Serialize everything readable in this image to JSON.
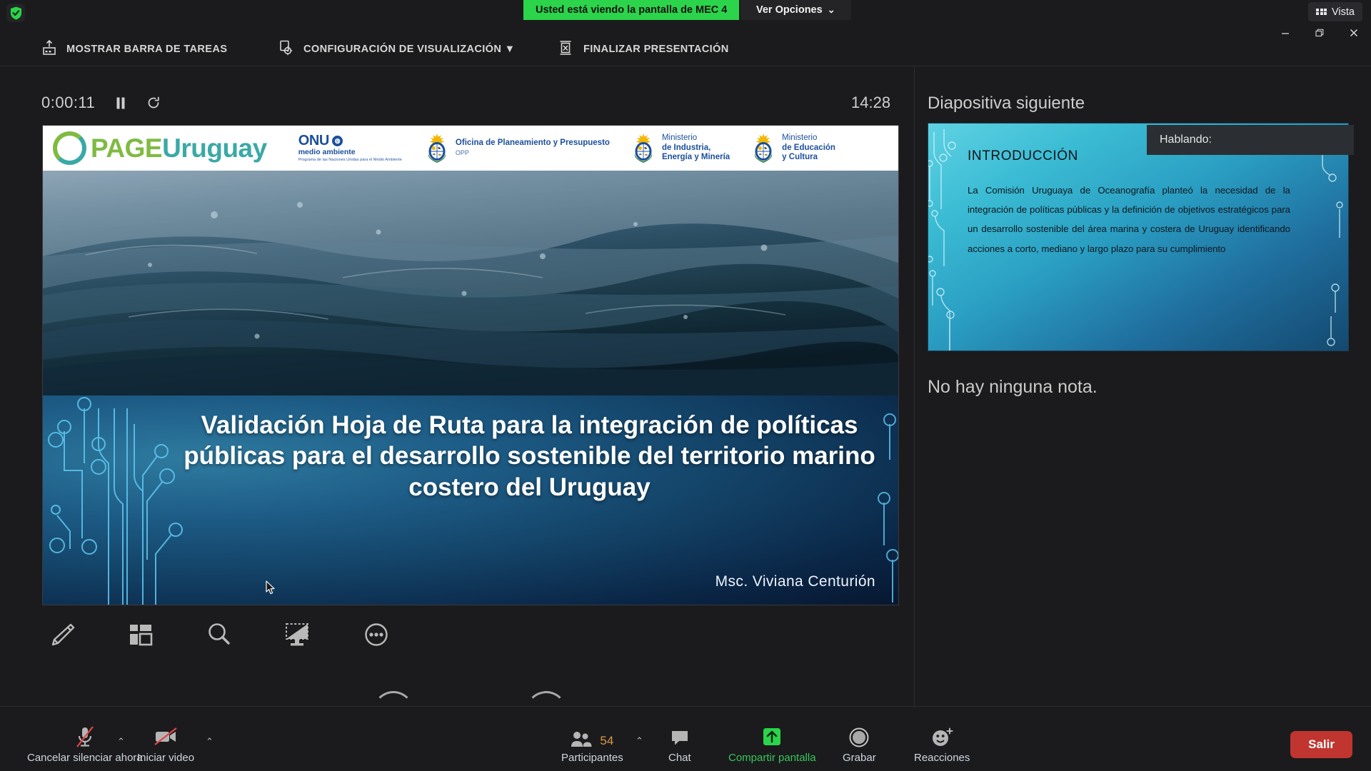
{
  "topbar": {
    "shield_icon": "shield-check-icon",
    "share_banner": "Usted está viendo la pantalla de MEC 4",
    "view_options": "Ver Opciones",
    "view_options_caret": "⌄",
    "vista_label": "Vista",
    "window_minimize": "—",
    "window_restore": "❐",
    "window_close": "✕"
  },
  "presenter_controls": {
    "show_taskbar": "MOSTRAR BARRA DE TAREAS",
    "display_settings": "CONFIGURACIÓN DE VISUALIZACIÓN ▼",
    "end_presentation": "FINALIZAR PRESENTACIÓN"
  },
  "timer": {
    "elapsed": "0:00:11",
    "pause_icon": "pause-icon",
    "reset_icon": "reset-icon",
    "clock": "14:28"
  },
  "slide": {
    "logos": {
      "page_part1": "PAGE",
      "page_part2": "Uruguay",
      "onu_title": "ONU",
      "onu_sub": "medio ambiente",
      "onu_fine": "Programa de las Naciones Unidas para el Medio Ambiente",
      "opp_line1": "Oficina de Planeamiento y Presupuesto",
      "opp_line2": "OPP",
      "miem_line1": "Ministerio",
      "miem_line2": "de Industria,",
      "miem_line3": "Energía y Minería",
      "mec_line1": "Ministerio",
      "mec_line2": "de Educación",
      "mec_line3": "y Cultura"
    },
    "title": "Validación Hoja de Ruta para la integración de políticas públicas para el desarrollo sostenible del territorio marino costero del Uruguay",
    "author": "Msc. Viviana Centurión"
  },
  "tools": [
    {
      "name": "pen-icon",
      "label": "Pluma"
    },
    {
      "name": "slide-grid-icon",
      "label": "Ver todas las diapositivas"
    },
    {
      "name": "magnifier-icon",
      "label": "Acercar"
    },
    {
      "name": "black-screen-icon",
      "label": "Pantalla en negro"
    },
    {
      "name": "more-options-icon",
      "label": "Más opciones"
    }
  ],
  "next_panel": {
    "heading": "Diapositiva siguiente",
    "speaking_label": "Hablando:",
    "slide_title": "INTRODUCCIÓN",
    "slide_body": "La Comisión Uruguaya de Oceanografía planteó la necesidad de la integración de políticas públicas y la definición de objetivos estratégicos para un desarrollo sostenible del área marina y costera de Uruguay identificando acciones a corto, mediano y largo plazo para su cumplimiento",
    "notes": "No hay ninguna nota."
  },
  "bottom_bar": {
    "mute": {
      "label": "Cancelar silenciar ahora",
      "icon": "mic-muted-icon",
      "caret": "⌃"
    },
    "video": {
      "label": "Iniciar video",
      "icon": "video-off-icon",
      "caret": "⌃"
    },
    "participants": {
      "label": "Participantes",
      "count": "54",
      "icon": "people-icon",
      "caret": "⌃"
    },
    "chat": {
      "label": "Chat",
      "icon": "chat-bubble-icon"
    },
    "share": {
      "label": "Compartir pantalla",
      "icon": "share-arrow-up-icon"
    },
    "record": {
      "label": "Grabar",
      "icon": "record-circle-icon"
    },
    "reactions": {
      "label": "Reacciones",
      "icon": "smiley-plus-icon"
    },
    "leave": {
      "label": "Salir"
    }
  },
  "colors": {
    "share_green": "#2bd44a",
    "accent_green": "#35c75a",
    "count_orange": "#d99a49",
    "leave_red": "#c0352f",
    "panel_bg": "#1b1b1d",
    "label_blue": "#cfd6de"
  }
}
